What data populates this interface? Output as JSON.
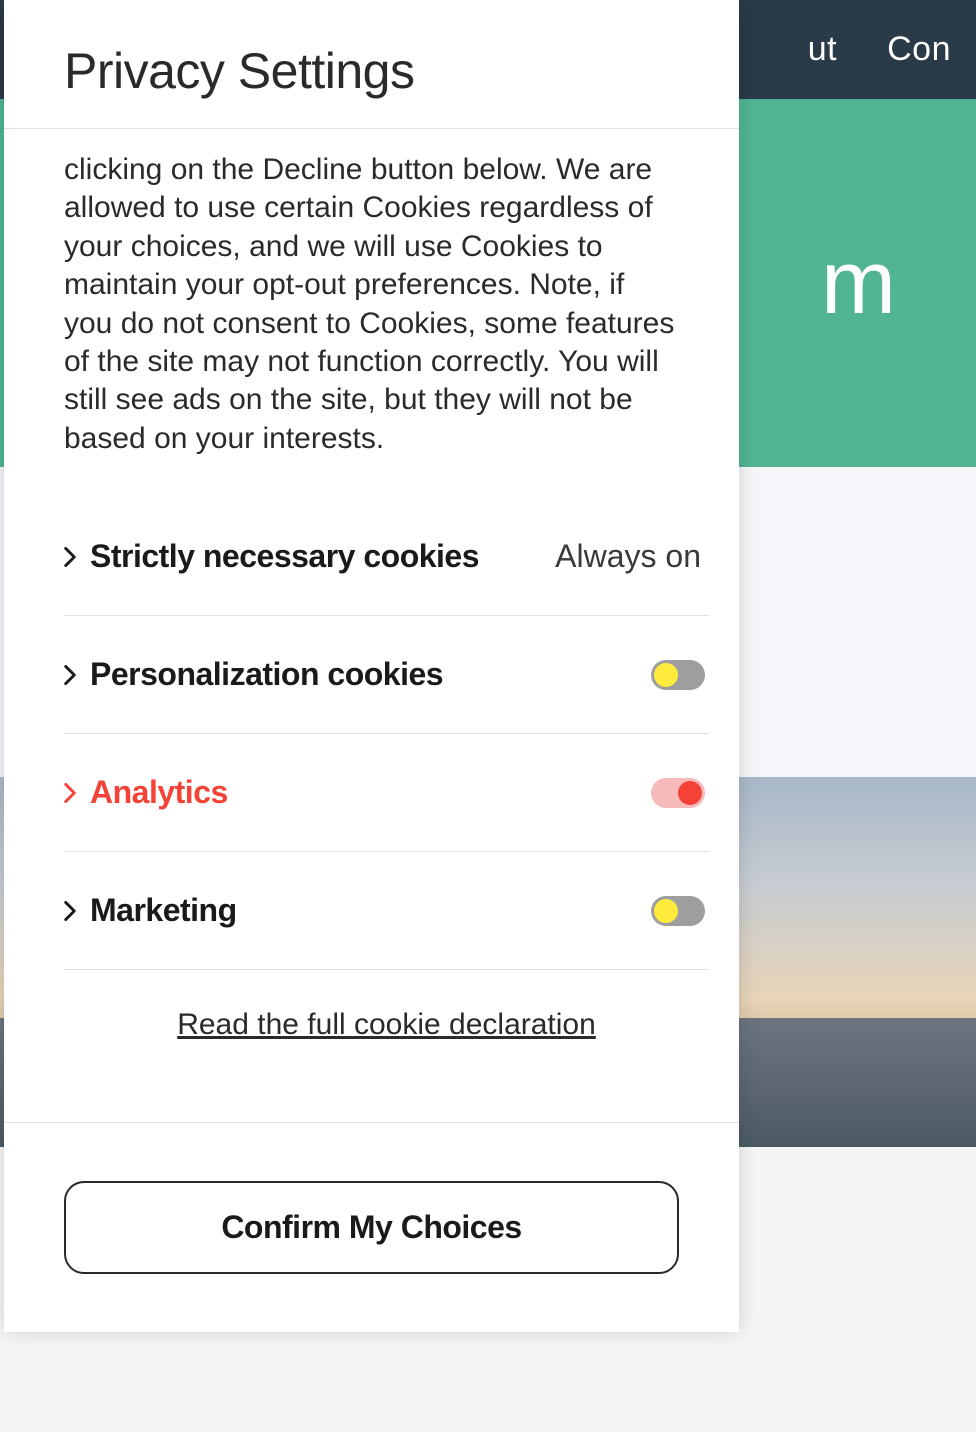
{
  "background": {
    "nav": {
      "item1": "ut",
      "item2": "Con"
    },
    "hero_text": "m"
  },
  "modal": {
    "title": "Privacy Settings",
    "description": "clicking on the Decline button below. We are allowed to use certain Cookies regardless of your choices, and we will use Cookies to maintain your opt-out preferences. Note, if you do not consent to Cookies, some features of the site may not function correctly. You will still see ads on the site, but they will not be based on your interests.",
    "categories": [
      {
        "label": "Strictly necessary cookies",
        "status": "Always on",
        "kind": "locked"
      },
      {
        "label": "Personalization cookies",
        "state": "off",
        "kind": "toggle"
      },
      {
        "label": "Analytics",
        "state": "on",
        "kind": "toggle",
        "highlighted": true
      },
      {
        "label": "Marketing",
        "state": "off",
        "kind": "toggle"
      }
    ],
    "declaration_link": "Read the full cookie declaration",
    "confirm_button": "Confirm My Choices"
  }
}
